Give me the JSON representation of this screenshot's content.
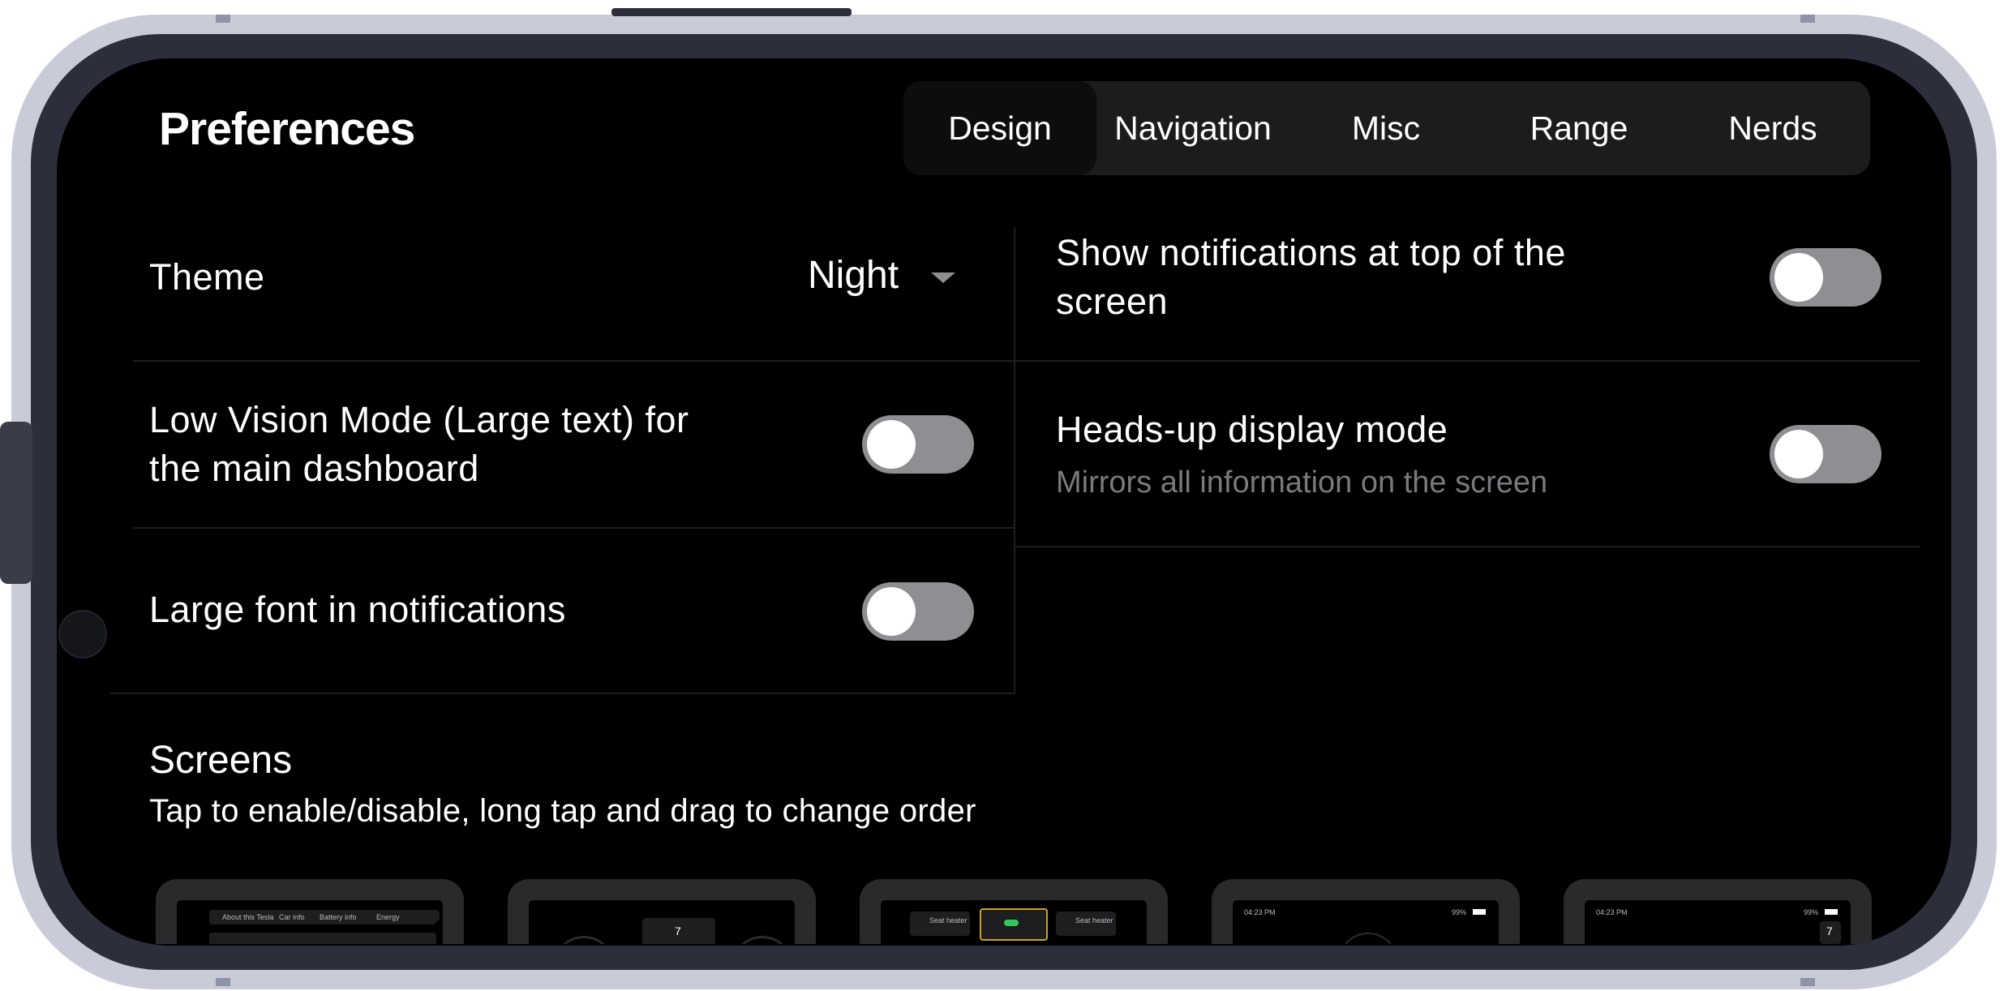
{
  "header": {
    "title": "Preferences"
  },
  "tabs": [
    {
      "label": "Design",
      "active": true
    },
    {
      "label": "Navigation",
      "active": false
    },
    {
      "label": "Misc",
      "active": false
    },
    {
      "label": "Range",
      "active": false
    },
    {
      "label": "Nerds",
      "active": false
    }
  ],
  "settings": {
    "theme": {
      "label": "Theme",
      "value": "Night"
    },
    "low_vision": {
      "label_line1": "Low Vision Mode (Large text) for",
      "label_line2": "the main dashboard",
      "enabled": false
    },
    "large_font": {
      "label": "Large font in notifications",
      "enabled": false
    },
    "notifications_top": {
      "label_line1": "Show notifications at top of the",
      "label_line2": "screen",
      "enabled": false
    },
    "hud": {
      "label": "Heads-up display mode",
      "sublabel": "Mirrors all information on the screen",
      "enabled": false
    }
  },
  "screens": {
    "title": "Screens",
    "subtitle": "Tap to enable/disable, long tap and drag to change order",
    "thumbs": [
      {
        "tabs": [
          "About this Tesla",
          "Car info",
          "Battery info",
          "Energy"
        ]
      },
      {
        "number": "7"
      },
      {
        "buttons": [
          "Seat heater",
          "",
          "Seat heater"
        ]
      },
      {
        "time": "04:23 PM",
        "battery": "99%"
      },
      {
        "time": "04:23 PM",
        "battery": "99%",
        "number": "7"
      }
    ]
  },
  "colors": {
    "background": "#000000",
    "accent": "#ffffff",
    "toggle_off": "#8e8e93",
    "tab_bar": "#1c1c1e"
  }
}
